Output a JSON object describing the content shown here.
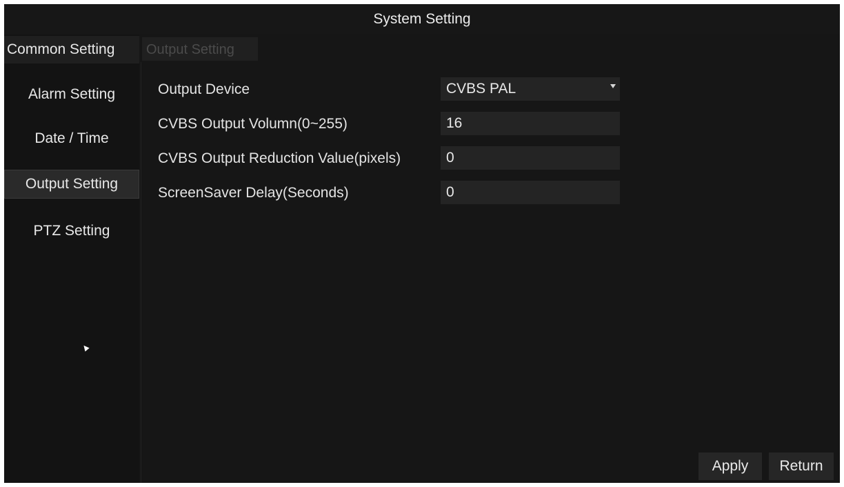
{
  "window": {
    "title": "System Setting"
  },
  "sidebar": {
    "header_tab": "Common Setting",
    "items": [
      {
        "label": "Alarm Setting"
      },
      {
        "label": "Date / Time"
      },
      {
        "label": "Output Setting",
        "selected": true
      },
      {
        "label": "PTZ Setting"
      }
    ]
  },
  "panel": {
    "tab_label": "Output Setting",
    "fields": [
      {
        "label": "Output Device",
        "value": "CVBS PAL",
        "type": "dropdown"
      },
      {
        "label": "CVBS Output Volumn(0~255)",
        "value": "16",
        "type": "input"
      },
      {
        "label": "CVBS Output Reduction Value(pixels)",
        "value": "0",
        "type": "input"
      },
      {
        "label": "ScreenSaver Delay(Seconds)",
        "value": "0",
        "type": "input"
      }
    ]
  },
  "buttons": {
    "apply": "Apply",
    "return": "Return"
  },
  "icons": {
    "dropdown": "chevron-down-icon",
    "cursor": "mouse-cursor-icon"
  },
  "colors": {
    "background": "#161616",
    "field": "#242424",
    "text": "#e6e6e6",
    "tab_inactive_text": "#4b4b4b"
  }
}
